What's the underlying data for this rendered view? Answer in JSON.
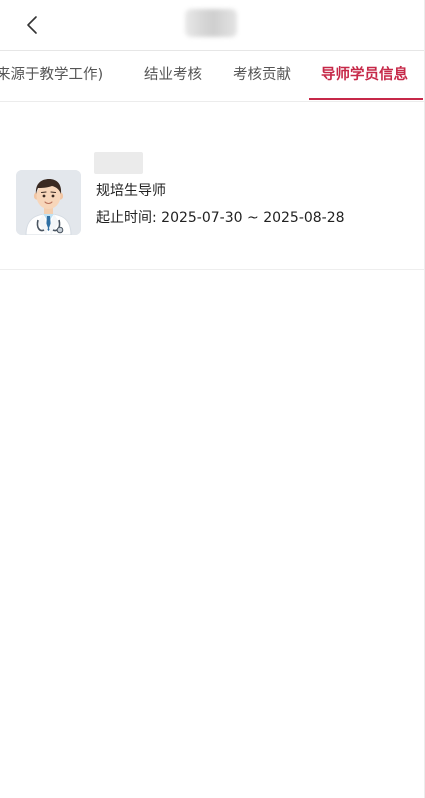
{
  "header": {
    "back_icon": "chevron-left-icon"
  },
  "tabs": [
    {
      "label": "来源于教学工作)",
      "active": false
    },
    {
      "label": "结业考核",
      "active": false
    },
    {
      "label": "考核贡献",
      "active": false
    },
    {
      "label": "导师学员信息",
      "active": true
    }
  ],
  "mentor": {
    "role": "规培生导师",
    "period_label": "起止时间:",
    "start_date": "2025-07-30",
    "separator": "~",
    "end_date": "2025-08-28",
    "avatar_icon": "doctor-avatar-icon"
  },
  "colors": {
    "accent": "#c62848",
    "tab_text": "#555555",
    "divider": "#e6e6e6"
  }
}
